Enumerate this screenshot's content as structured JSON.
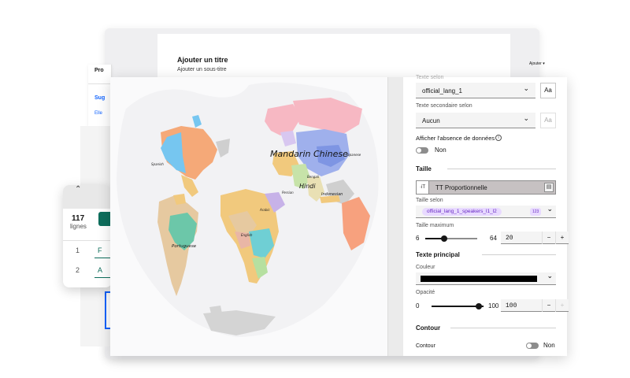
{
  "colors": {
    "accent": "#0f62fe",
    "purple_tag": "#6929c4",
    "green": "#0e6e5c"
  },
  "back_doc": {
    "title": "Ajouter un titre",
    "subtitle": "Ajouter un sous-titre",
    "menu": "Ajouter"
  },
  "left_card": {
    "item1": "Pro",
    "item2": "Sug",
    "item3": "Elle"
  },
  "rows_card": {
    "count": "117",
    "count_label": "lignes",
    "rows": [
      {
        "num": "1",
        "val": "F"
      },
      {
        "num": "2",
        "val": "A"
      }
    ]
  },
  "map": {
    "labels": {
      "mandarin": "Mandarin Chinese",
      "hindi": "Hindi",
      "indonesian": "Indonesian",
      "bengali": "Bengali",
      "persian": "Persian",
      "arabic": "Arabic",
      "portuguese": "Portuguese",
      "spanish": "Spanish",
      "english": "English",
      "japanese": "Japanese"
    }
  },
  "panel": {
    "texte_selon_label": "Texte selon",
    "texte_selon_value": "official_lang_1",
    "aa_label": "Aa",
    "texte_secondaire_label": "Texte secondaire selon",
    "texte_secondaire_value": "Aucun",
    "absence_label": "Afficher l'absence de données",
    "absence_toggle": "Non",
    "taille_section": "Taille",
    "size_mode_icon": "·iT",
    "size_mode_label": "TT  Proportionnelle",
    "taille_selon_label": "Taille selon",
    "taille_selon_value": "official_lang_1_speakers_l1_l2",
    "taille_selon_type": "123",
    "taille_max_label": "Taille maximum",
    "taille_min_val": "6",
    "taille_max_val": "64",
    "taille_input": "20",
    "texte_principal_section": "Texte principal",
    "couleur_label": "Couleur",
    "couleur_value": "#000000",
    "opacite_label": "Opacité",
    "opacite_min": "0",
    "opacite_max": "100",
    "opacite_input": "100",
    "contour_section": "Contour",
    "contour_label": "Contour",
    "contour_toggle": "Non",
    "minus": "−",
    "plus": "+"
  }
}
